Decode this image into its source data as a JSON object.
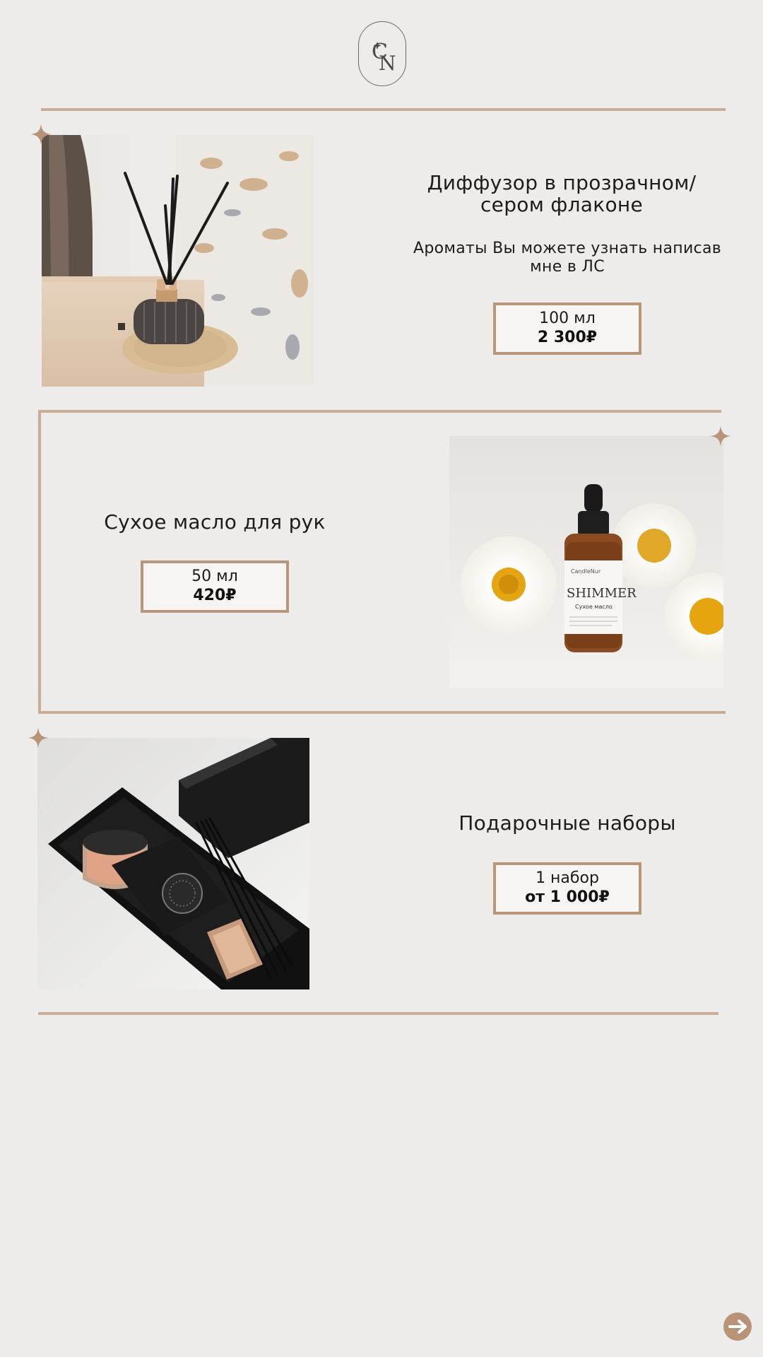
{
  "brand": {
    "logo_letters": "CN",
    "accent_color": "#c8ad99",
    "box_border_color": "#b8967a"
  },
  "products": [
    {
      "title_line1": "Диффузор в прозрачном/",
      "title_line2": "сером флаконе",
      "desc_line1": "Ароматы Вы можете узнать написав",
      "desc_line2": "мне в ЛС",
      "volume": "100 мл",
      "price": "2 300₽",
      "image_icon": "reed-diffuser-photo"
    },
    {
      "title_line1": "Сухое масло для рук",
      "volume": "50 мл",
      "price": "420₽",
      "image_icon": "dry-oil-bottle-photo",
      "image_label_brand": "CandleNur",
      "image_label_name": "SHIMMER",
      "image_label_sub": "Сухое масло"
    },
    {
      "title_line1": "Подарочные наборы",
      "volume": "1 набор",
      "price": "от 1 000₽",
      "image_icon": "gift-box-photo"
    }
  ],
  "navigation": {
    "next_icon": "arrow-right-icon"
  }
}
